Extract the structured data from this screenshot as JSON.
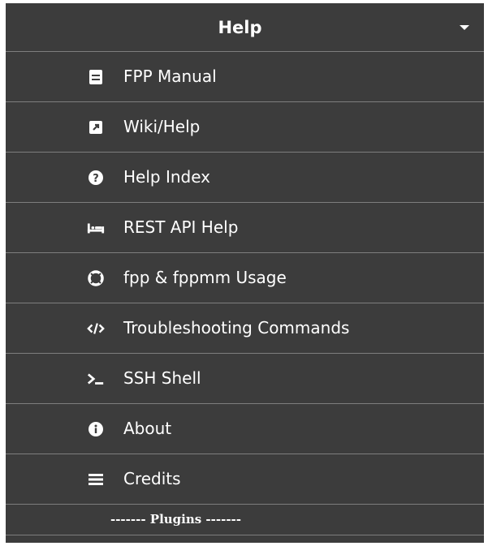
{
  "header": {
    "title": "Help",
    "caret_icon": "caret-down-icon"
  },
  "items": [
    {
      "label": "FPP Manual",
      "icon": "book-icon"
    },
    {
      "label": "Wiki/Help",
      "icon": "external-link-icon"
    },
    {
      "label": "Help Index",
      "icon": "question-circle-icon"
    },
    {
      "label": "REST API Help",
      "icon": "bed-icon"
    },
    {
      "label": "fpp & fppmm Usage",
      "icon": "life-ring-icon"
    },
    {
      "label": "Troubleshooting Commands",
      "icon": "code-icon"
    },
    {
      "label": "SSH Shell",
      "icon": "terminal-icon"
    },
    {
      "label": "About",
      "icon": "info-circle-icon"
    },
    {
      "label": "Credits",
      "icon": "bars-icon"
    }
  ],
  "section": {
    "plugins_label": "------- Plugins -------"
  },
  "colors": {
    "menu_bg": "#3c3c3c",
    "divider": "#7e7e7e",
    "text": "#ffffff"
  }
}
